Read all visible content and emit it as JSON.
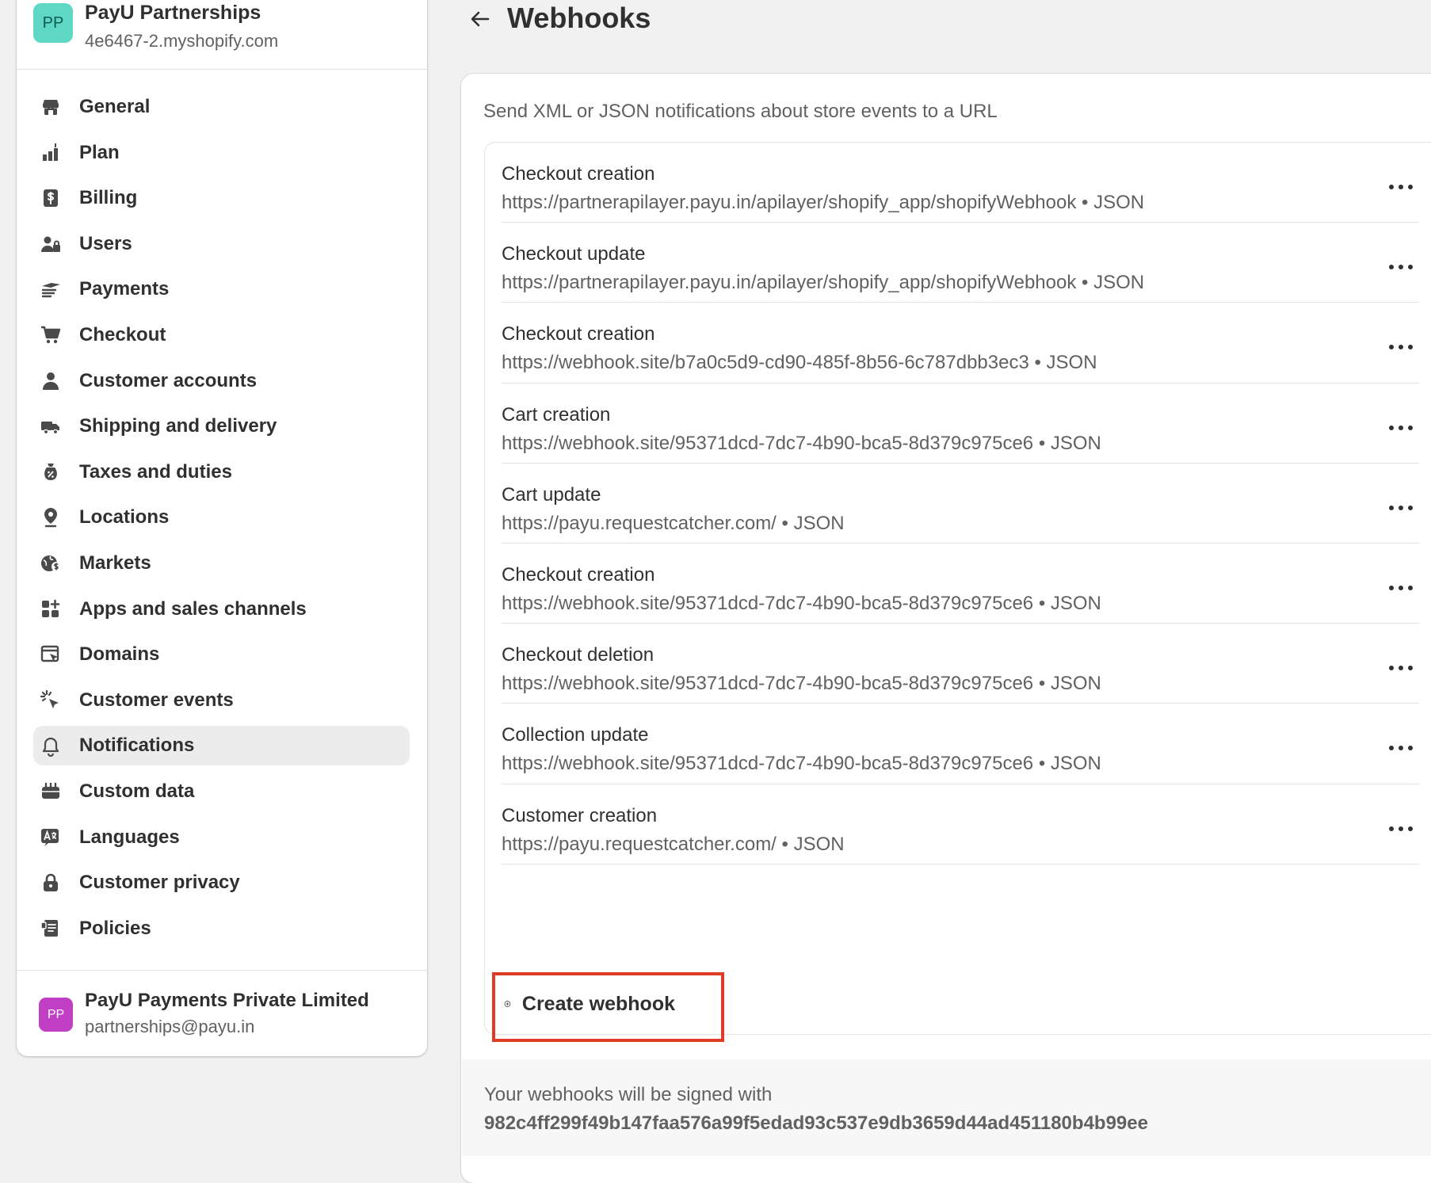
{
  "store": {
    "initials": "PP",
    "name": "PayU Partnerships",
    "domain": "4e6467-2.myshopify.com"
  },
  "nav": [
    {
      "label": "General",
      "icon": "store-icon"
    },
    {
      "label": "Plan",
      "icon": "plan-icon"
    },
    {
      "label": "Billing",
      "icon": "billing-icon"
    },
    {
      "label": "Users",
      "icon": "users-icon"
    },
    {
      "label": "Payments",
      "icon": "payments-icon"
    },
    {
      "label": "Checkout",
      "icon": "cart-icon"
    },
    {
      "label": "Customer accounts",
      "icon": "person-icon"
    },
    {
      "label": "Shipping and delivery",
      "icon": "truck-icon"
    },
    {
      "label": "Taxes and duties",
      "icon": "tax-icon"
    },
    {
      "label": "Locations",
      "icon": "location-pin-icon"
    },
    {
      "label": "Markets",
      "icon": "globe-icon"
    },
    {
      "label": "Apps and sales channels",
      "icon": "apps-icon"
    },
    {
      "label": "Domains",
      "icon": "domains-icon"
    },
    {
      "label": "Customer events",
      "icon": "cursor-click-icon"
    },
    {
      "label": "Notifications",
      "icon": "bell-icon",
      "active": true
    },
    {
      "label": "Custom data",
      "icon": "custom-data-icon"
    },
    {
      "label": "Languages",
      "icon": "language-icon"
    },
    {
      "label": "Customer privacy",
      "icon": "lock-icon"
    },
    {
      "label": "Policies",
      "icon": "policies-icon"
    }
  ],
  "account": {
    "initials": "PP",
    "name": "PayU Payments Private Limited",
    "email": "partnerships@payu.in"
  },
  "page": {
    "title": "Webhooks",
    "description": "Send XML or JSON notifications about store events to a URL"
  },
  "webhooks": [
    {
      "event": "Checkout creation",
      "detail": "https://partnerapilayer.payu.in/apilayer/shopify_app/shopifyWebhook • JSON"
    },
    {
      "event": "Checkout update",
      "detail": "https://partnerapilayer.payu.in/apilayer/shopify_app/shopifyWebhook • JSON"
    },
    {
      "event": "Checkout creation",
      "detail": "https://webhook.site/b7a0c5d9-cd90-485f-8b56-6c787dbb3ec3 • JSON"
    },
    {
      "event": "Cart creation",
      "detail": "https://webhook.site/95371dcd-7dc7-4b90-bca5-8d379c975ce6 • JSON"
    },
    {
      "event": "Cart update",
      "detail": "https://payu.requestcatcher.com/ • JSON"
    },
    {
      "event": "Checkout creation",
      "detail": "https://webhook.site/95371dcd-7dc7-4b90-bca5-8d379c975ce6 • JSON"
    },
    {
      "event": "Checkout deletion",
      "detail": "https://webhook.site/95371dcd-7dc7-4b90-bca5-8d379c975ce6 • JSON"
    },
    {
      "event": "Collection update",
      "detail": "https://webhook.site/95371dcd-7dc7-4b90-bca5-8d379c975ce6 • JSON"
    },
    {
      "event": "Customer creation",
      "detail": "https://payu.requestcatcher.com/ • JSON"
    }
  ],
  "create_button": {
    "label": "Create webhook",
    "icon": "plus-circle-icon"
  },
  "signing": {
    "text": "Your webhooks will be signed with",
    "key": "982c4ff299f49b147faa576a99f5edad93c537e9db3659d44ad451180b4b99ee"
  },
  "colors": {
    "store_avatar": "#5ed8c5",
    "account_avatar": "#c03fc5",
    "highlight": "#e03b26",
    "active_nav": "#ececec"
  }
}
